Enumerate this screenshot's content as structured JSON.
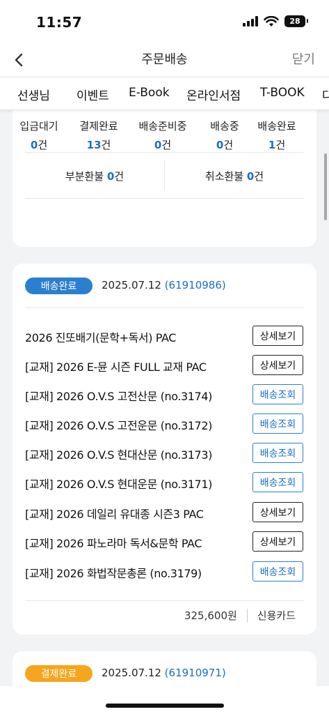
{
  "status": {
    "time": "11:57",
    "battery": "28"
  },
  "nav": {
    "title": "주문배송",
    "close_label": "닫기"
  },
  "tabs": [
    "선생님",
    "이벤트",
    "E-Book",
    "온라인서점",
    "T-BOOK",
    "다"
  ],
  "summary": {
    "stages": [
      {
        "label": "입금대기",
        "count": "0",
        "unit": "건"
      },
      {
        "label": "결제완료",
        "count": "13",
        "unit": "건"
      },
      {
        "label": "배송준비중",
        "count": "0",
        "unit": "건"
      },
      {
        "label": "배송중",
        "count": "0",
        "unit": "건"
      },
      {
        "label": "배송완료",
        "count": "1",
        "unit": "건"
      }
    ],
    "refunds": [
      {
        "label": "부분환불 ",
        "count": "0",
        "unit": "건"
      },
      {
        "label": "취소환불 ",
        "count": "0",
        "unit": "건"
      }
    ]
  },
  "orders": [
    {
      "status": "배송완료",
      "status_color": "#2b7fd0",
      "date": "2025.07.12",
      "order_no": "(61910986)",
      "items": [
        {
          "title": "2026 진또배기(문학+독서) PAC",
          "button": "상세보기",
          "type": "detail"
        },
        {
          "title": "[교재] 2026 E-뮨 시즌 FULL 교재 PAC",
          "button": "상세보기",
          "type": "detail"
        },
        {
          "title": "[교재] 2026 O.V.S 고전산문 (no.3174)",
          "button": "배송조회",
          "type": "track"
        },
        {
          "title": "[교재] 2026 O.V.S 고전운문 (no.3172)",
          "button": "배송조회",
          "type": "track"
        },
        {
          "title": "[교재] 2026 O.V.S 현대산문 (no.3173)",
          "button": "배송조회",
          "type": "track"
        },
        {
          "title": "[교재] 2026 O.V.S 현대운문 (no.3171)",
          "button": "배송조회",
          "type": "track"
        },
        {
          "title": "[교재] 2026 데일리 유대종 시즌3 PAC",
          "button": "상세보기",
          "type": "detail"
        },
        {
          "title": "[교재] 2026 파노라마 독서&문학 PAC",
          "button": "상세보기",
          "type": "detail"
        },
        {
          "title": "[교재] 2026 화법작문총론 (no.3179)",
          "button": "배송조회",
          "type": "track"
        }
      ],
      "amount": "325,600원",
      "payment": "신용카드"
    },
    {
      "status": "결제완료",
      "status_color": "#f7a51c",
      "date": "2025.07.12",
      "order_no": "(61910971)"
    }
  ]
}
